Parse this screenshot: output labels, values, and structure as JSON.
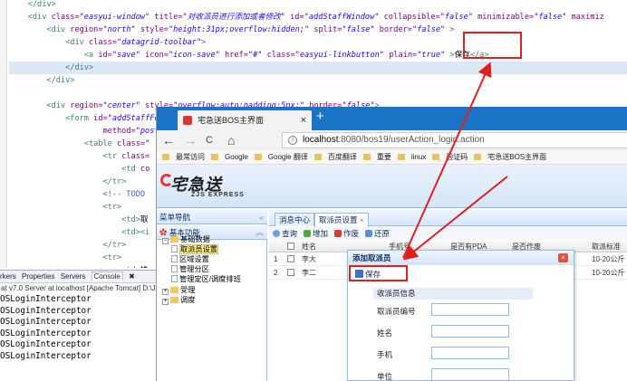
{
  "editor": {
    "lines": [
      [
        [
          "tg",
          "</div>"
        ]
      ],
      [
        [
          "tg",
          "<div "
        ],
        [
          "at",
          "class="
        ],
        [
          "av",
          "\"easyui-window\""
        ],
        [
          "at",
          " title="
        ],
        [
          "av",
          "\"对收派员进行添加或者修改\""
        ],
        [
          "at",
          " id="
        ],
        [
          "av",
          "\"addStaffWindow\""
        ],
        [
          "at",
          " collapsible="
        ],
        [
          "av",
          "\"false\""
        ],
        [
          "at",
          " minimizable="
        ],
        [
          "av",
          "\"false\""
        ],
        [
          "at",
          " maximiz"
        ]
      ],
      [
        [
          "tg",
          "<div "
        ],
        [
          "at",
          "region="
        ],
        [
          "av",
          "\"north\""
        ],
        [
          "at",
          " style="
        ],
        [
          "av",
          "\"height:31px;overflow:hidden;\""
        ],
        [
          "at",
          " split="
        ],
        [
          "av",
          "\"false\""
        ],
        [
          "at",
          " border="
        ],
        [
          "av",
          "\"false\""
        ],
        [
          "tg",
          " >"
        ]
      ],
      [
        [
          "tg",
          "<div "
        ],
        [
          "at",
          "class="
        ],
        [
          "av",
          "\"datagrid-toolbar\""
        ],
        [
          "tg",
          ">"
        ]
      ],
      [
        [
          "tg",
          "<a "
        ],
        [
          "at",
          "id="
        ],
        [
          "av",
          "\"save\""
        ],
        [
          "at",
          " icon="
        ],
        [
          "av",
          "\"icon-save\""
        ],
        [
          "at",
          " href="
        ],
        [
          "av",
          "\"#\""
        ],
        [
          "at",
          " class="
        ],
        [
          "av",
          "\"easyui-linkbutton\""
        ],
        [
          "at",
          " plain="
        ],
        [
          "av",
          "\"true\""
        ],
        [
          "tg",
          " >"
        ],
        [
          "tx",
          "保存"
        ],
        [
          "tg",
          "</a>"
        ]
      ],
      [
        [
          "tg",
          "</div>"
        ]
      ],
      [
        [
          "tg",
          "</div>"
        ]
      ],
      [
        [
          "tx",
          ""
        ]
      ],
      [
        [
          "tg",
          "<div "
        ],
        [
          "at",
          "region="
        ],
        [
          "av",
          "\"center\""
        ],
        [
          "at",
          " style="
        ],
        [
          "av",
          "\"overflow:auto;padding:5px;\""
        ],
        [
          "at",
          " border="
        ],
        [
          "av",
          "\"false\""
        ],
        [
          "tg",
          ">"
        ]
      ],
      [
        [
          "tg",
          "<form "
        ],
        [
          "at",
          "id="
        ],
        [
          "av",
          "\"addStaffForm\""
        ],
        [
          "at",
          " action="
        ],
        [
          "av",
          "\"${pageContext.request.contextPath }/staffAction_add.action\""
        ]
      ],
      [
        [
          "at",
          "method="
        ],
        [
          "av",
          "\"post\""
        ],
        [
          "tg",
          ">"
        ]
      ],
      [
        [
          "tg",
          "<table "
        ],
        [
          "at",
          "class="
        ],
        [
          "av",
          "\""
        ]
      ],
      [
        [
          "tg",
          "<tr "
        ],
        [
          "at",
          "class="
        ]
      ],
      [
        [
          "tg",
          "<td "
        ],
        [
          "at",
          "co"
        ]
      ],
      [
        [
          "tg",
          "</tr>"
        ]
      ],
      [
        [
          "cm",
          "<!-- TODO"
        ]
      ],
      [
        [
          "tg",
          "<tr>"
        ]
      ],
      [
        [
          "tg",
          "<td>"
        ],
        [
          "tx",
          "取"
        ]
      ],
      [
        [
          "tg",
          "<td><i"
        ]
      ],
      [
        [
          "tg",
          "</tr>"
        ]
      ],
      [
        [
          "tg",
          "<tr>"
        ]
      ],
      [
        [
          "tg",
          "<td>"
        ],
        [
          "tx",
          "姓"
        ]
      ],
      [
        [
          "tg",
          "<td><i"
        ]
      ],
      [
        [
          "tg",
          "</tr>"
        ]
      ],
      [
        [
          "tg",
          "<tr>"
        ]
      ]
    ]
  },
  "console": {
    "tabs": [
      "rkers",
      "Properties",
      "Servers",
      "Console",
      "✖"
    ],
    "server_line": "at v7.0 Server at localhost [Apache Tomcat] D:\\J",
    "lines": [
      "OSLoginInterceptor",
      "OSLoginInterceptor",
      "OSLoginInterceptor",
      "OSLoginInterceptor",
      "OSLoginInterceptor",
      "OSLoginInterceptor"
    ]
  },
  "browser": {
    "tab_title": "宅急送BOS主界面",
    "tab_close": "×",
    "new_tab": "+",
    "nav": {
      "back": "←",
      "forward": "→",
      "reload": "C",
      "home": "⌂"
    },
    "url_host": "localhost",
    "url_rest": ":8080/bos19/userAction_login.action",
    "url_info": "i",
    "bookmarks": [
      "最常访问",
      "Google",
      "Google 翻译",
      "百度翻译",
      "重要",
      "linux",
      "验证码",
      "宅急送BOS主界面"
    ]
  },
  "app": {
    "logo": "宅急送",
    "logo_sub": "ZJS EXPRESS",
    "nav_title": "菜单导航",
    "nav_collapse": "«",
    "section_title": "基本功能",
    "section_arrow": "︽",
    "tree": [
      {
        "label": "基础数据",
        "kind": "folder",
        "sign": "−"
      },
      {
        "label": "取派员设置",
        "kind": "doc",
        "selected": true
      },
      {
        "label": "区域设置",
        "kind": "doc"
      },
      {
        "label": "管理分区",
        "kind": "doc"
      },
      {
        "label": "管理定区/调度排班",
        "kind": "doc"
      },
      {
        "label": "受理",
        "kind": "folder",
        "sign": "+"
      },
      {
        "label": "调度",
        "kind": "folder",
        "sign": "+"
      }
    ],
    "tabs": [
      {
        "label": "消息中心"
      },
      {
        "label": "取派员设置",
        "close": "×"
      }
    ],
    "toolbar": [
      "查询",
      "增加",
      "作废",
      "还原"
    ],
    "grid": {
      "headers": [
        "姓名",
        "手机号",
        "是否有PDA",
        "是否作废",
        "取派标准"
      ],
      "rows": [
        {
          "num": "1",
          "name": "李大",
          "std": "10-20公斤"
        },
        {
          "num": "2",
          "name": "李二",
          "std": "10-20公斤"
        }
      ]
    }
  },
  "dialog": {
    "title": "添加取派员",
    "close": "×",
    "save": "保存",
    "form_header": "收派员信息",
    "fields": [
      "取派员编号",
      "姓名",
      "手机",
      "单位"
    ]
  },
  "colors": {
    "annotation": "#e02020",
    "browser_tab_bar": "#1a73c4",
    "easyui_border": "#99bbe8"
  }
}
